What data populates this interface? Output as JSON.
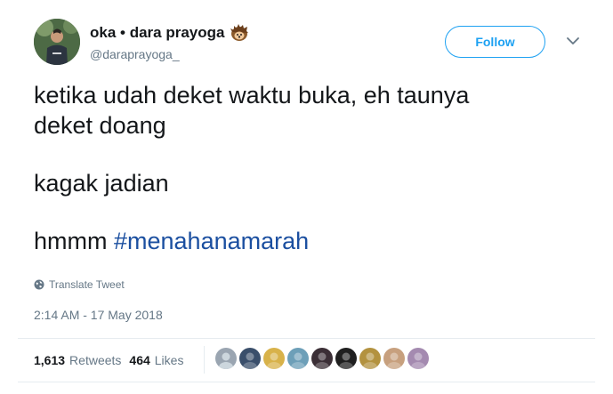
{
  "author": {
    "display_name": "oka • dara prayoga",
    "handle": "@daraprayoga_",
    "avatar_icon": "user-avatar",
    "name_emoji": "hedgehog-emoji"
  },
  "follow_button": {
    "label": "Follow"
  },
  "menu_icon": "chevron-down-icon",
  "tweet": {
    "line1": "ketika udah deket waktu buka, eh taunya",
    "line2": "deket doang",
    "line3": "kagak jadian",
    "line4_text": "hmmm ",
    "hashtag": "#menahanamarah"
  },
  "translate": {
    "label": "Translate Tweet",
    "icon": "globe-icon"
  },
  "timestamp": "2:14 AM - 17 May 2018",
  "stats": {
    "retweets_count": "1,613",
    "retweets_label": "Retweets",
    "likes_count": "464",
    "likes_label": "Likes"
  },
  "likers": [
    {
      "color": "#9aa5b1"
    },
    {
      "color": "#3a4f6b"
    },
    {
      "color": "#d8b24a"
    },
    {
      "color": "#6d9fb8"
    },
    {
      "color": "#3b2f36"
    },
    {
      "color": "#1f1f1f"
    },
    {
      "color": "#b3923f"
    },
    {
      "color": "#c7a07e"
    },
    {
      "color": "#a48ab0"
    }
  ],
  "colors": {
    "accent": "#1da1f2",
    "hashtag": "#1b4fa0",
    "muted": "#657786",
    "text": "#14171a"
  }
}
